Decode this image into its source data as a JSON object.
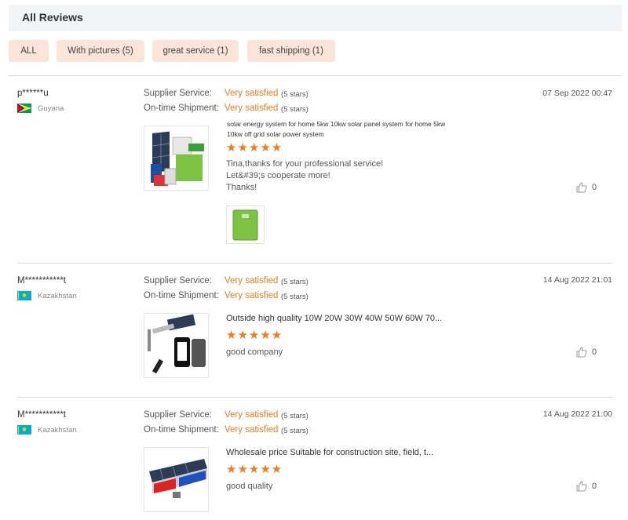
{
  "header": {
    "title": "All Reviews"
  },
  "filters": [
    {
      "label": "ALL"
    },
    {
      "label": "With pictures (5)"
    },
    {
      "label": "great service (1)"
    },
    {
      "label": "fast shipping (1)"
    }
  ],
  "labels": {
    "supplier_service": "Supplier Service:",
    "ontime_shipment": "On-time Shipment:"
  },
  "colors": {
    "accent": "#f07c1e",
    "filter_bg": "#fbe4d8",
    "header_bg": "#f3f4f6"
  },
  "reviews": [
    {
      "reviewer": "p******u",
      "country": "Guyana",
      "date": "07 Sep 2022 00:47",
      "supplier_value": "Very satisfied",
      "supplier_stars": "(5 stars)",
      "shipment_value": "Very satisfied",
      "shipment_stars": "(5 stars)",
      "product_title": "solar energy system for home 5kw 10kw solar panel system for home 5kw 10kw off grid solar power system",
      "rating": "★★★★★",
      "comment_lines": [
        "Tina,thanks for your professional service!",
        "Let&#39;s cooperate more!",
        "Thanks!"
      ],
      "likes": "0"
    },
    {
      "reviewer": "M***********t",
      "country": "Kazakhstan",
      "date": "14 Aug 2022 21:01",
      "supplier_value": "Very satisfied",
      "supplier_stars": "(5 stars)",
      "shipment_value": "Very satisfied",
      "shipment_stars": "(5 stars)",
      "product_title": "Outside high quality 10W 20W 30W 40W 50W 60W 70...",
      "rating": "★★★★★",
      "comment": "good company",
      "likes": "0"
    },
    {
      "reviewer": "M***********t",
      "country": "Kazakhstan",
      "date": "14 Aug 2022 21:00",
      "supplier_value": "Very satisfied",
      "supplier_stars": "(5 stars)",
      "shipment_value": "Very satisfied",
      "shipment_stars": "(5 stars)",
      "product_title": "Wholesale price Suitable for construction site, field, t...",
      "rating": "★★★★★",
      "comment": "good quality",
      "likes": "0"
    }
  ]
}
